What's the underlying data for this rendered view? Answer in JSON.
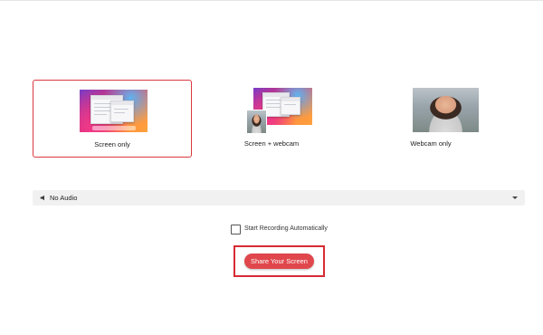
{
  "options": [
    {
      "label": "Screen only",
      "selected": true
    },
    {
      "label": "Screen + webcam",
      "selected": false
    },
    {
      "label": "Webcam only",
      "selected": false
    }
  ],
  "audio": {
    "selected": "No Audio",
    "icon": "speaker-icon"
  },
  "auto_record": {
    "label": "Start Recording Automatically",
    "checked": false
  },
  "share_button": {
    "label": "Share Your Screen"
  },
  "colors": {
    "accent": "#e0474c",
    "highlight": "#d62b33",
    "select_bg": "#f1f1f1"
  }
}
